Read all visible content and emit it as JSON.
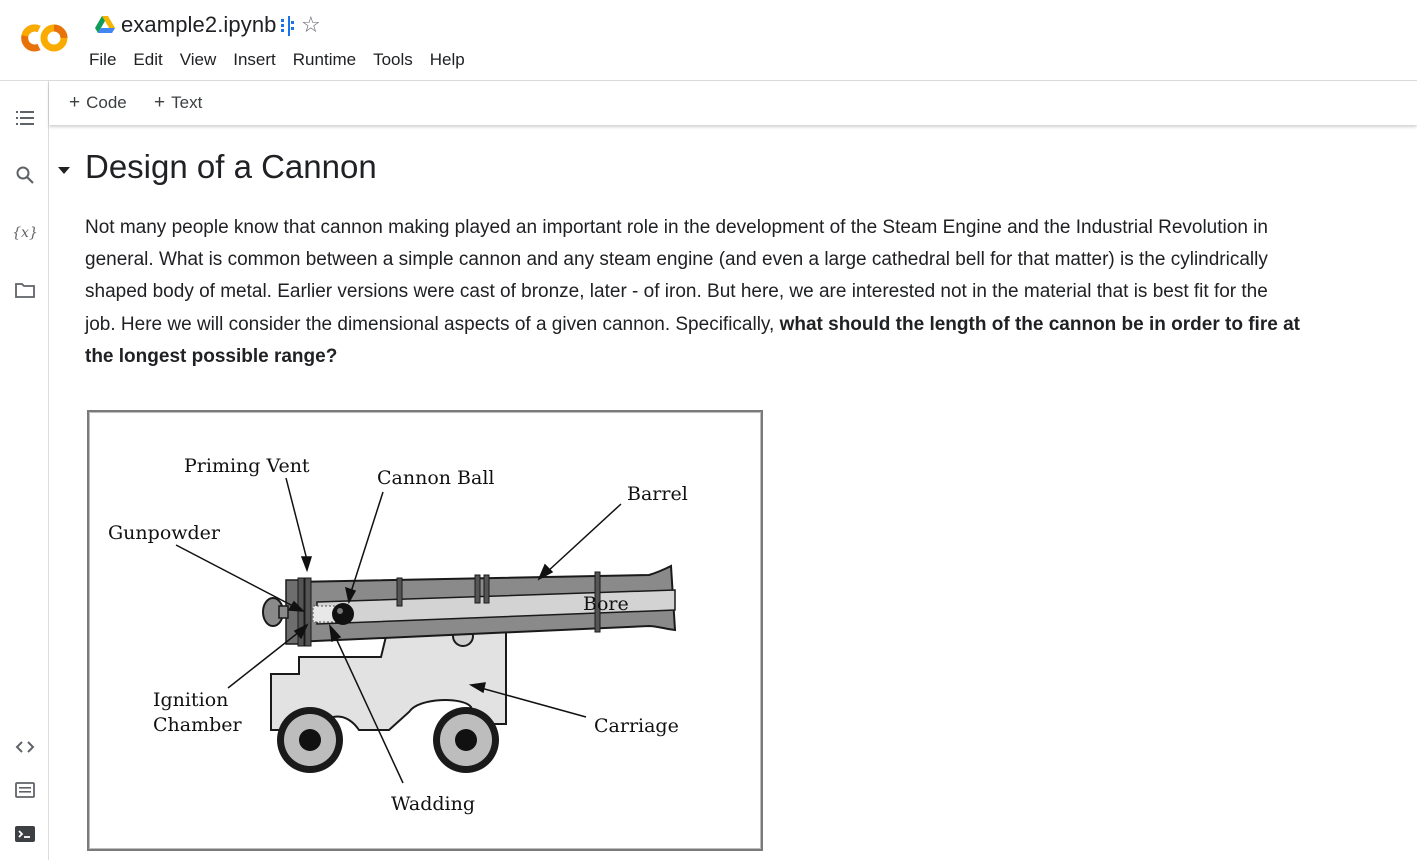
{
  "header": {
    "notebook_title": "example2.ipynb",
    "logo_text": "CO",
    "menu": [
      "File",
      "Edit",
      "View",
      "Insert",
      "Runtime",
      "Tools",
      "Help"
    ]
  },
  "toolbar": {
    "add_code_label": "Code",
    "add_text_label": "Text"
  },
  "sidebar": {
    "items": [
      "table-of-contents-icon",
      "search-icon",
      "variables-icon",
      "files-icon",
      "code-snippets-icon",
      "command-palette-icon",
      "terminal-icon"
    ]
  },
  "section": {
    "heading": "Design of a Cannon",
    "paragraph_lines": [
      "Not many people know that cannon making played an important role in the development of the Steam Engine and the Industrial Revolution in",
      "general. What is common between a simple cannon and any steam engine (and even a large cathedral bell for that matter) is the cylindrically",
      "shaped body of metal. Earlier versions were cast of bronze, later - of iron. But here, we are interested not in the material that is best fit for the"
    ],
    "paragraph_line4_regular": "job. Here we will consider the dimensional aspects of a given cannon. Specifically, ",
    "paragraph_line4_bold": "what should the length of the cannon be in order to fire at",
    "paragraph_line5_bold": "the longest possible range?"
  },
  "figure": {
    "labels": {
      "priming_vent": "Priming Vent",
      "cannon_ball": "Cannon Ball",
      "barrel": "Barrel",
      "gunpowder": "Gunpowder",
      "bore": "Bore",
      "ignition_line1": "Ignition",
      "ignition_line2": "Chamber",
      "carriage": "Carriage",
      "wadding": "Wadding"
    }
  },
  "colors": {
    "colab_orange": "#F9AB00",
    "colab_dark_orange": "#E8710A",
    "drive_green": "#0F9D58",
    "drive_blue": "#4285F4",
    "drive_yellow": "#F4B400"
  }
}
